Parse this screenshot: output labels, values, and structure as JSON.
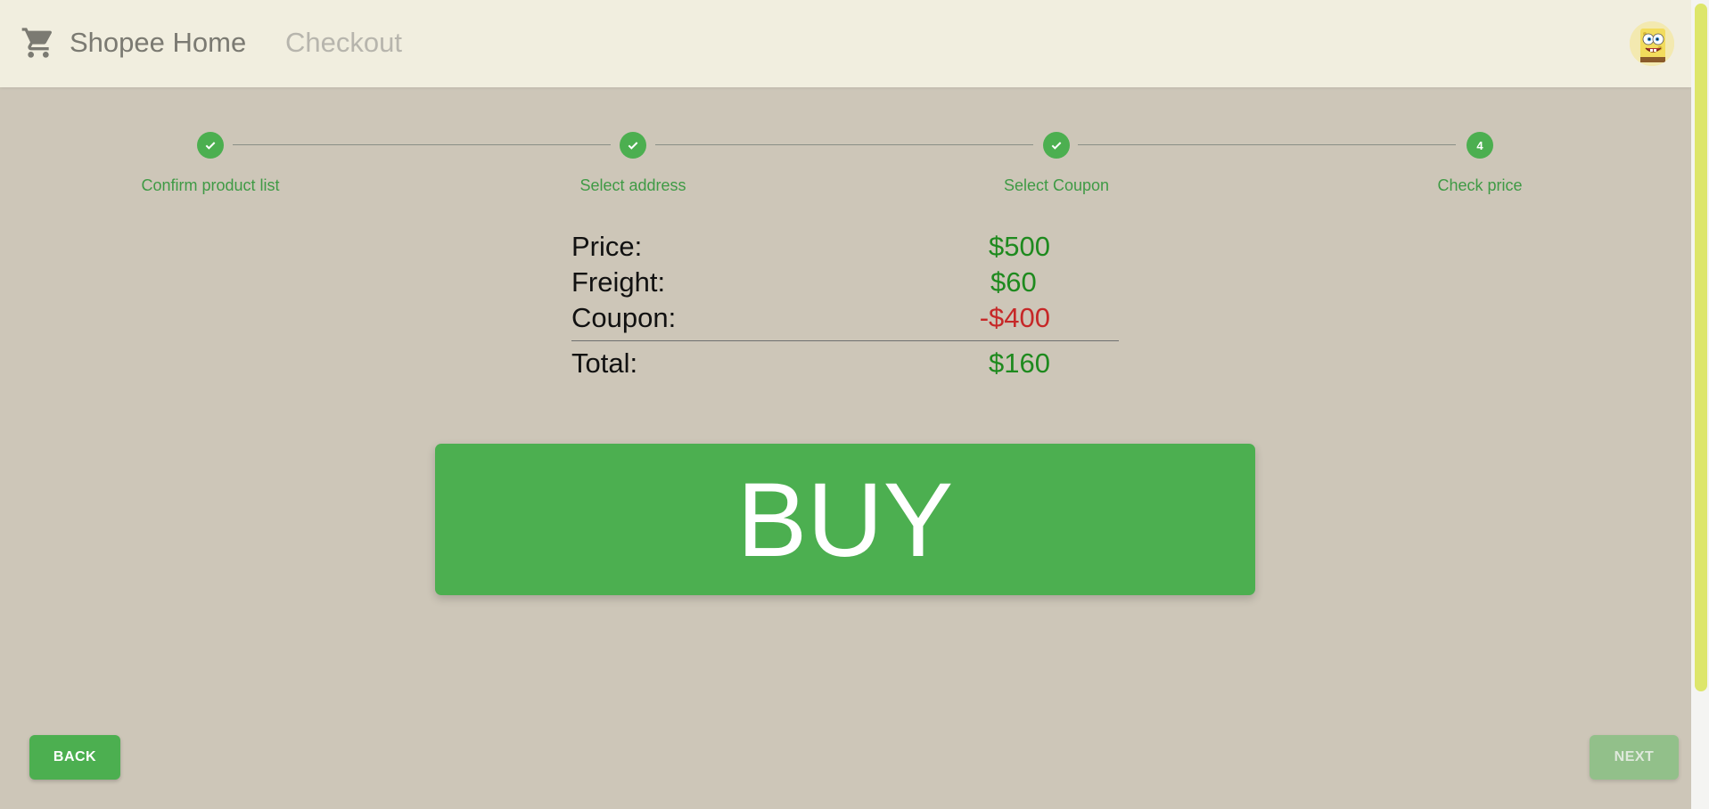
{
  "header": {
    "brand": "Shopee Home",
    "nav_checkout": "Checkout",
    "cart_icon": "shopping-cart-icon",
    "avatar_icon": "user-avatar"
  },
  "stepper": {
    "steps": [
      {
        "label": "Confirm product list",
        "state": "completed",
        "icon": "check-icon"
      },
      {
        "label": "Select address",
        "state": "completed",
        "icon": "check-icon"
      },
      {
        "label": "Select Coupon",
        "state": "completed",
        "icon": "check-icon"
      },
      {
        "label": "Check price",
        "state": "active",
        "number": "4"
      }
    ]
  },
  "summary": {
    "price_label": "Price:",
    "price_value": "$500",
    "freight_label": "Freight:",
    "freight_value": "$60",
    "coupon_label": "Coupon:",
    "coupon_value": "-$400",
    "total_label": "Total:",
    "total_value": "$160"
  },
  "actions": {
    "buy_label": "BUY",
    "back_label": "BACK",
    "next_label": "NEXT",
    "next_disabled": true
  },
  "colors": {
    "primary": "#4caf50",
    "positive_text": "#1e8a1e",
    "negative_text": "#c62828",
    "appbar_bg": "#f1eedf",
    "page_bg": "#cdc6b8",
    "scroll_thumb": "#dde66b"
  }
}
